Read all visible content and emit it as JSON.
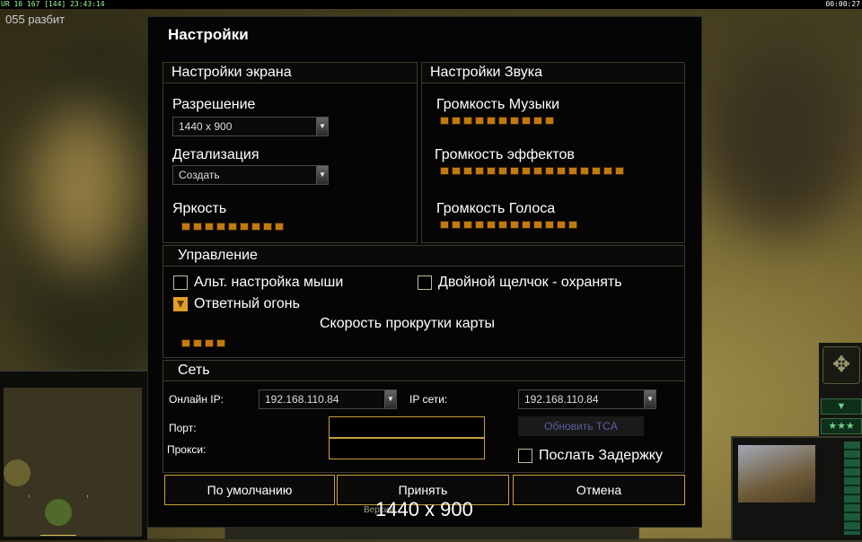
{
  "colors": {
    "accent": "#c9a040",
    "slider": "#c07a10",
    "panel_bg": "#050505"
  },
  "topbar": {
    "stats": "UR 10 167 [144] 23:43:14",
    "clock": "00:00:27"
  },
  "status": "055 разбит",
  "dialog": {
    "title": "Настройки",
    "screen": {
      "heading": "Настройки экрана",
      "resolution_label": "Разрешение",
      "resolution_value": "1440 x 900",
      "detail_label": "Детализация",
      "detail_value": "Создать",
      "brightness_label": "Яркость",
      "brightness_level": 9
    },
    "sound": {
      "heading": "Настройки Звука",
      "music_label": "Громкость Музыки",
      "music_level": 10,
      "effects_label": "Громкость эффектов",
      "effects_level": 16,
      "voice_label": "Громкость Голоса",
      "voice_level": 12
    },
    "control": {
      "heading": "Управление",
      "alt_mouse": "Альт. настройка мыши",
      "alt_mouse_checked": false,
      "double_click": "Двойной щелчок - охранять",
      "double_click_checked": false,
      "return_fire": "Ответный огонь",
      "return_fire_checked": true,
      "scroll_label": "Скорость прокрутки карты",
      "scroll_level": 4
    },
    "network": {
      "heading": "Сеть",
      "online_ip_label": "Онлайн IP:",
      "online_ip_value": "192.168.110.84",
      "lan_ip_label": "IP сети:",
      "lan_ip_value": "192.168.110.84",
      "port_label": "Порт:",
      "port_value": "",
      "proxy_label": "Прокси:",
      "proxy_value": "",
      "update_tca": "Обновить TCA",
      "send_delay": "Послать Задержку",
      "send_delay_checked": false
    },
    "buttons": {
      "default": "По умолчанию",
      "accept": "Принять",
      "cancel": "Отмена"
    },
    "version_label": "Версия",
    "overlay_resolution": "1440 x 900"
  },
  "side": {
    "compass_icon": "compass-icon",
    "stars": "★★★",
    "down_arrow": "▼"
  }
}
